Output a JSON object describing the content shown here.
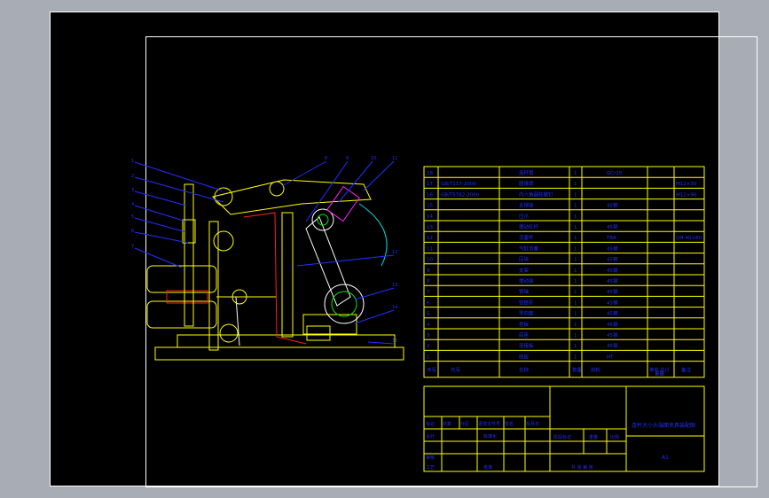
{
  "colors": {
    "background": "#000000",
    "frame": "#ffffff",
    "table_line": "#ffff00",
    "table_text": "#0000ff",
    "leader": "#2030ff",
    "outline_yellow": "#ffff00",
    "link_red": "#ff2020",
    "center_green": "#10e010",
    "hatch_magenta": "#ff20ff",
    "arc_cyan": "#00e0e0"
  },
  "bom": {
    "rows": [
      {
        "no": "18",
        "code": "",
        "name": "连杆销",
        "qty": "1",
        "material": "GCr15",
        "note": ""
      },
      {
        "no": "17",
        "code": "GB/T117-2000",
        "name": "圆锥销",
        "qty": "1",
        "material": "",
        "note": "M12×30"
      },
      {
        "no": "16",
        "code": "GB/T5782-2000",
        "name": "内六角圆柱螺钉",
        "qty": "1",
        "material": "",
        "note": "M12×90"
      },
      {
        "no": "15",
        "code": "",
        "name": "支撑座",
        "qty": "1",
        "material": "45钢",
        "note": ""
      },
      {
        "no": "14",
        "code": "",
        "name": "压爪",
        "qty": "1",
        "material": "",
        "note": ""
      },
      {
        "no": "13",
        "code": "",
        "name": "摆动杠杆",
        "qty": "1",
        "material": "45钢",
        "note": ""
      },
      {
        "no": "12",
        "code": "",
        "name": "活塞杆",
        "qty": "1",
        "material": "T8A",
        "note": "QH-40×80"
      },
      {
        "no": "11",
        "code": "",
        "name": "气缸活塞",
        "qty": "1",
        "material": "45钢",
        "note": ""
      },
      {
        "no": "10",
        "code": "",
        "name": "压块",
        "qty": "1",
        "material": "45钢",
        "note": ""
      },
      {
        "no": "9",
        "code": "",
        "name": "支架",
        "qty": "1",
        "material": "45钢",
        "note": ""
      },
      {
        "no": "8",
        "code": "",
        "name": "摆动架",
        "qty": "1",
        "material": "45钢",
        "note": ""
      },
      {
        "no": "7",
        "code": "",
        "name": "销轴",
        "qty": "1",
        "material": "45钢",
        "note": ""
      },
      {
        "no": "6",
        "code": "",
        "name": "铰链杆",
        "qty": "1",
        "material": "45钢",
        "note": ""
      },
      {
        "no": "5",
        "code": "",
        "name": "导向套",
        "qty": "1",
        "material": "45钢",
        "note": ""
      },
      {
        "no": "4",
        "code": "",
        "name": "垫板",
        "qty": "1",
        "material": "45钢",
        "note": ""
      },
      {
        "no": "3",
        "code": "",
        "name": "底座",
        "qty": "1",
        "material": "45钢",
        "note": ""
      },
      {
        "no": "2",
        "code": "",
        "name": "连接板",
        "qty": "1",
        "material": "45钢",
        "note": ""
      },
      {
        "no": "1",
        "code": "",
        "name": "底板",
        "qty": "1",
        "material": "HT",
        "note": ""
      }
    ],
    "header": {
      "no": "序号",
      "code": "代号",
      "name": "名称",
      "qty": "数量",
      "material": "材料",
      "single": "单件",
      "total": "总计",
      "weight": "重量",
      "note": "备注"
    }
  },
  "title_block": {
    "drawing_title": "连杆大小头端面夹具装配图",
    "sheet": "A1",
    "row_labels": [
      "标记",
      "处数",
      "分区",
      "更改文件号",
      "签名",
      "年月日"
    ],
    "design": "设计",
    "standardize": "标准化",
    "stage_mark": "阶段标记",
    "weight": "重量",
    "scale": "比例",
    "review": "审核",
    "process": "工艺",
    "approve": "批准",
    "total_sheets": "共 张 第 张"
  },
  "callouts": [
    "1",
    "2",
    "3",
    "4",
    "5",
    "6",
    "7",
    "8",
    "9",
    "10",
    "11",
    "12",
    "13",
    "14",
    "15",
    "16",
    "17",
    "18"
  ]
}
